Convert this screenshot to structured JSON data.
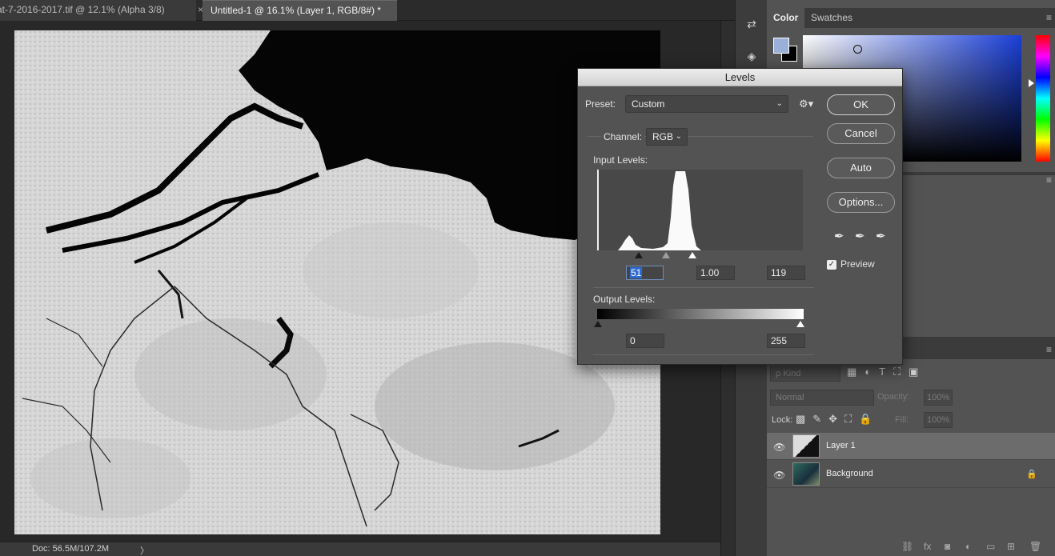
{
  "document_tabs": [
    {
      "label": "at-7-2016-2017.tif @ 12.1% (Alpha 3/8)",
      "close": "×"
    },
    {
      "label": "Untitled-1 @ 16.1% (Layer 1, RGB/8#) *"
    }
  ],
  "status_bar": {
    "doc_info": "Doc: 56.5M/107.2M",
    "arrow": "〉"
  },
  "color_panel": {
    "tabs": [
      "Color",
      "Swatches"
    ],
    "foreground_color": "#9bb0d8",
    "background_color": "#000000",
    "menu_icon": "≡"
  },
  "levels_dialog": {
    "title": "Levels",
    "preset_label": "Preset:",
    "preset_value": "Custom",
    "channel_label": "Channel:",
    "channel_value": "RGB",
    "input_levels_label": "Input Levels:",
    "input_black": "51",
    "input_gamma": "1.00",
    "input_white": "119",
    "output_levels_label": "Output Levels:",
    "output_black": "0",
    "output_white": "255",
    "buttons": {
      "ok": "OK",
      "cancel": "Cancel",
      "auto": "Auto",
      "options": "Options..."
    },
    "preview_label": "Preview",
    "preview_checked": true
  },
  "layers_panel": {
    "kind_filter": "ρ Kind",
    "blend_mode": "Normal",
    "opacity_label": "Opacity:",
    "opacity_value": "100%",
    "lock_label": "Lock:",
    "fill_label": "Fill:",
    "fill_value": "100%",
    "layers": [
      {
        "name": "Layer 1",
        "selected": true
      },
      {
        "name": "Background",
        "selected": false,
        "locked": true
      }
    ]
  }
}
